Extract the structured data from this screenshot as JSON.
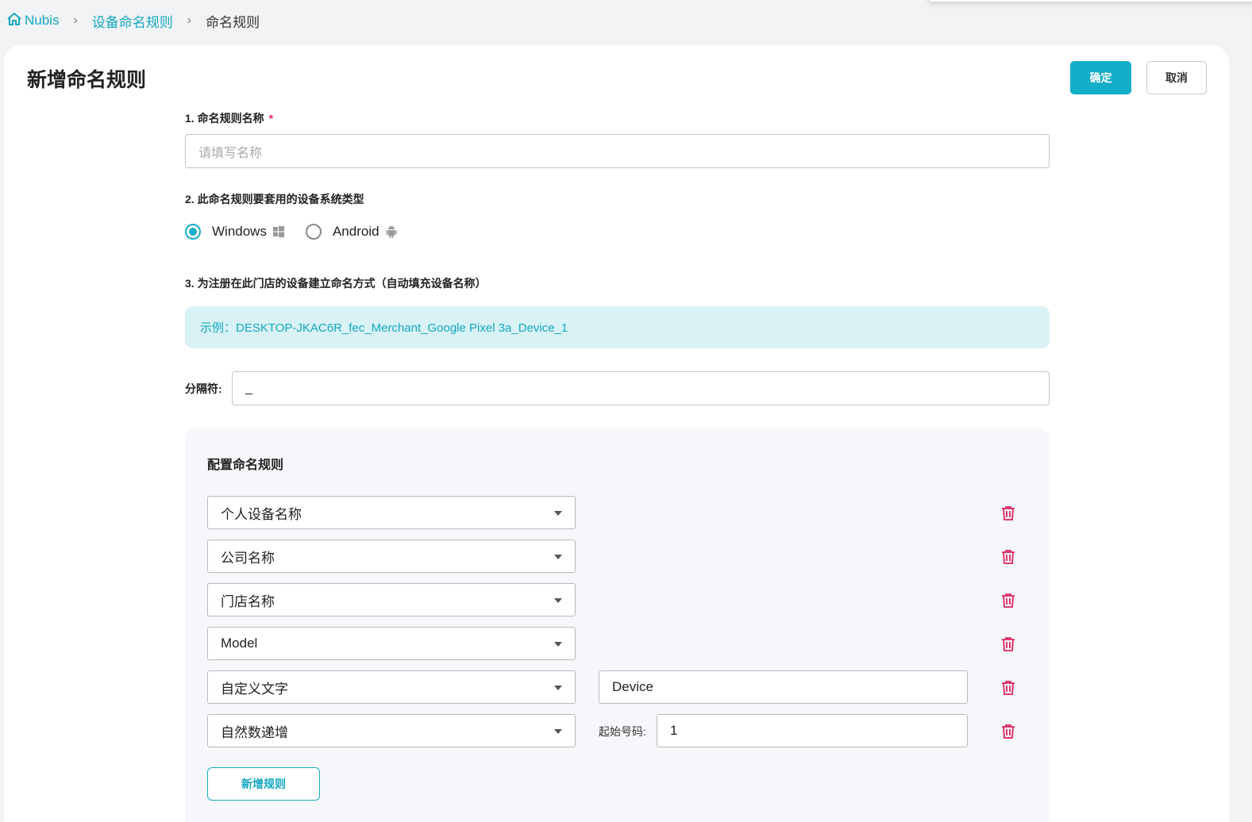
{
  "breadcrumb": {
    "home": "Nubis",
    "level1": "设备命名规则",
    "current": "命名规则"
  },
  "page": {
    "title": "新增命名规则",
    "confirm_label": "确定",
    "cancel_label": "取消"
  },
  "form": {
    "name_label": "1. 命名规则名称",
    "required_mark": "*",
    "name_placeholder": "请填写名称",
    "os_label": "2. 此命名规则要套用的设备系统类型",
    "os_options": [
      {
        "label": "Windows",
        "icon": "windows-icon",
        "selected": true
      },
      {
        "label": "Android",
        "icon": "android-icon",
        "selected": false
      }
    ],
    "naming_label": "3. 为注册在此门店的设备建立命名方式（自动填充设备名称）",
    "example": "示例：DESKTOP-JKAC6R_fec_Merchant_Google Pixel 3a_Device_1",
    "separator_label": "分隔符:",
    "separator_value": "_"
  },
  "rules": {
    "title": "配置命名规则",
    "items": [
      {
        "type": "个人设备名称"
      },
      {
        "type": "公司名称"
      },
      {
        "type": "门店名称"
      },
      {
        "type": "Model"
      },
      {
        "type": "自定义文字",
        "custom_text": "Device"
      },
      {
        "type": "自然数递增",
        "start_label": "起始号码:",
        "start_value": "1"
      }
    ],
    "add_label": "新增规则"
  },
  "colors": {
    "accent": "#13aec8",
    "danger": "#e0245e",
    "example_bg": "#d9f2f5"
  }
}
